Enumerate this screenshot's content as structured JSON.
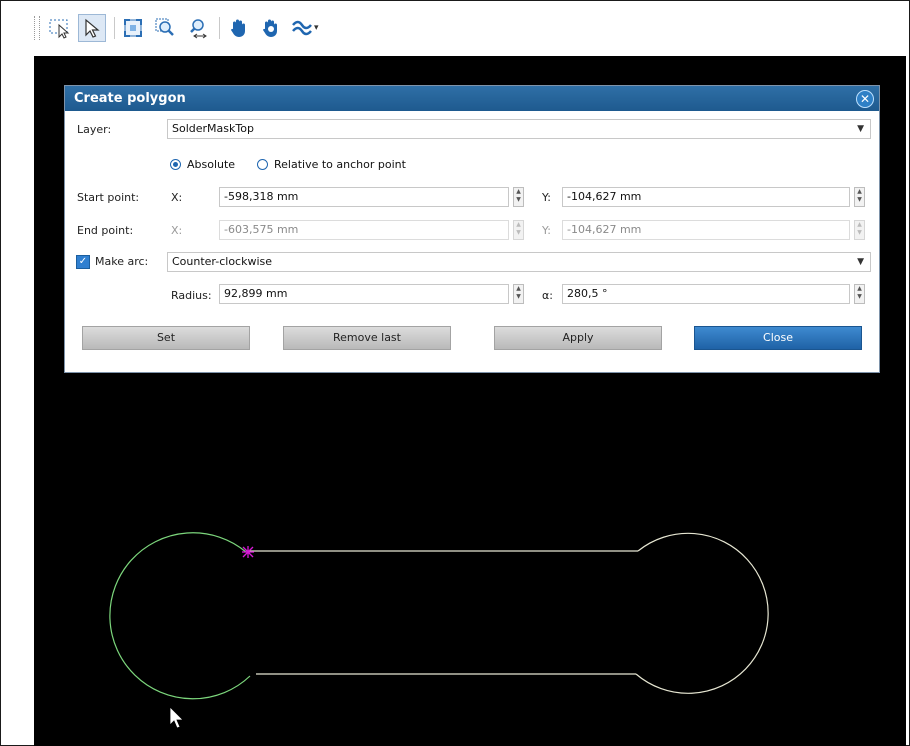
{
  "toolbar": {
    "tools": [
      {
        "icon": "rectangle-select-icon"
      },
      {
        "icon": "pointer-select-icon",
        "active": true
      },
      {
        "icon": "zoom-fit-icon"
      },
      {
        "icon": "zoom-window-icon"
      },
      {
        "icon": "zoom-in-out-icon"
      },
      {
        "icon": "pan-hand-icon"
      },
      {
        "icon": "pan-hand-alt-icon"
      },
      {
        "icon": "snap-dropdown-icon"
      }
    ]
  },
  "dialog": {
    "title": "Create polygon",
    "layer_label": "Layer:",
    "layer_value": "SolderMaskTop",
    "mode_absolute": "Absolute",
    "mode_relative": "Relative to anchor point",
    "start_label": "Start point:",
    "start_x_label": "X:",
    "start_x": "-598,318 mm",
    "start_y_label": "Y:",
    "start_y": "-104,627 mm",
    "end_label": "End point:",
    "end_x_label": "X:",
    "end_x": "-603,575 mm",
    "end_y_label": "Y:",
    "end_y": "-104,627 mm",
    "make_arc_label": "Make arc:",
    "make_arc_checked": true,
    "arc_direction": "Counter-clockwise",
    "radius_label": "Radius:",
    "radius_value": "92,899 mm",
    "alpha_label": "α:",
    "alpha_value": "280,5 °",
    "buttons": {
      "set": "Set",
      "remove_last": "Remove last",
      "apply": "Apply",
      "close": "Close"
    }
  },
  "colors": {
    "canvas_bg": "#000000",
    "arc_in_progress": "#7cd67c",
    "outline": "#e6e6d2",
    "anchor_marker": "#d61ad6",
    "accent": "#1f62a6"
  }
}
